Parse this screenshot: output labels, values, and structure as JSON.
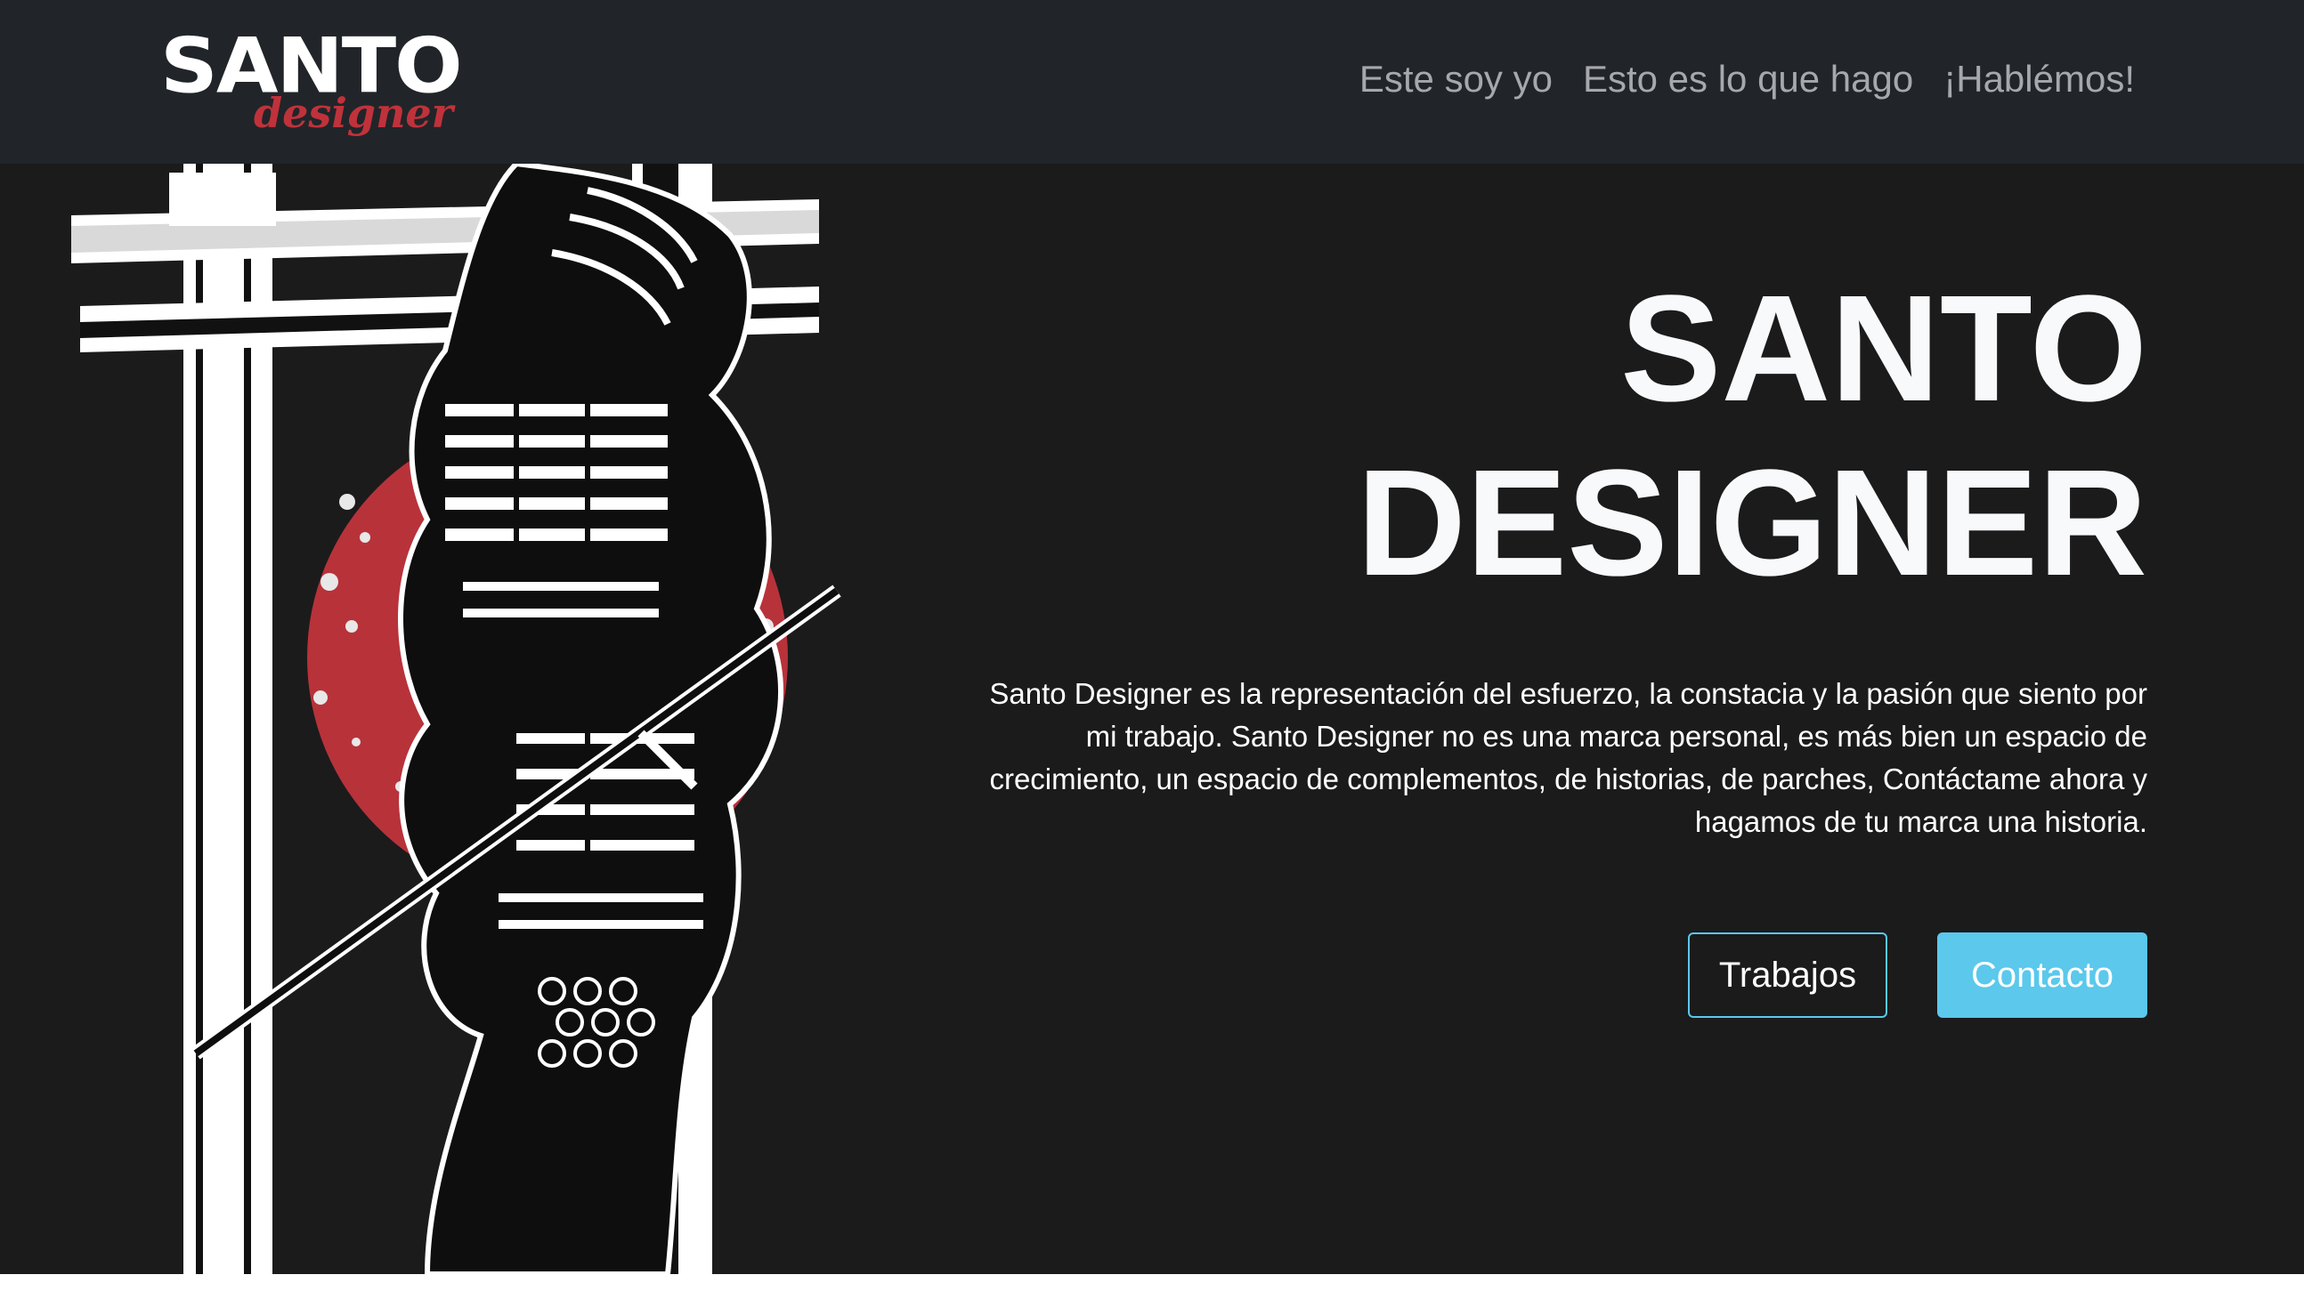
{
  "navbar": {
    "brand_main": "SANTO",
    "brand_sub": "designer",
    "links": [
      "Este soy yo",
      "Esto es lo que hago",
      "¡Hablémos!"
    ]
  },
  "hero": {
    "title_line1": "SANTO",
    "title_line2": "DESIGNER",
    "description": "Santo Designer es la representación del esfuerzo, la constacia y la pasión que siento por mi trabajo. Santo Designer no es una marca personal, es más bien un espacio de crecimiento, un espacio de complementos, de historias, de parches, Contáctame ahora y hagamos de tu marca una historia.",
    "buttons": {
      "primary_outline": "Trabajos",
      "primary_solid": "Contacto"
    },
    "illustration": "samurai-illustration"
  },
  "colors": {
    "navbar_bg": "#212529",
    "hero_bg": "#1b1b1c",
    "accent_red": "#b8323a",
    "accent_blue": "#5bc8ec",
    "nav_link": "#a6a8ab"
  }
}
